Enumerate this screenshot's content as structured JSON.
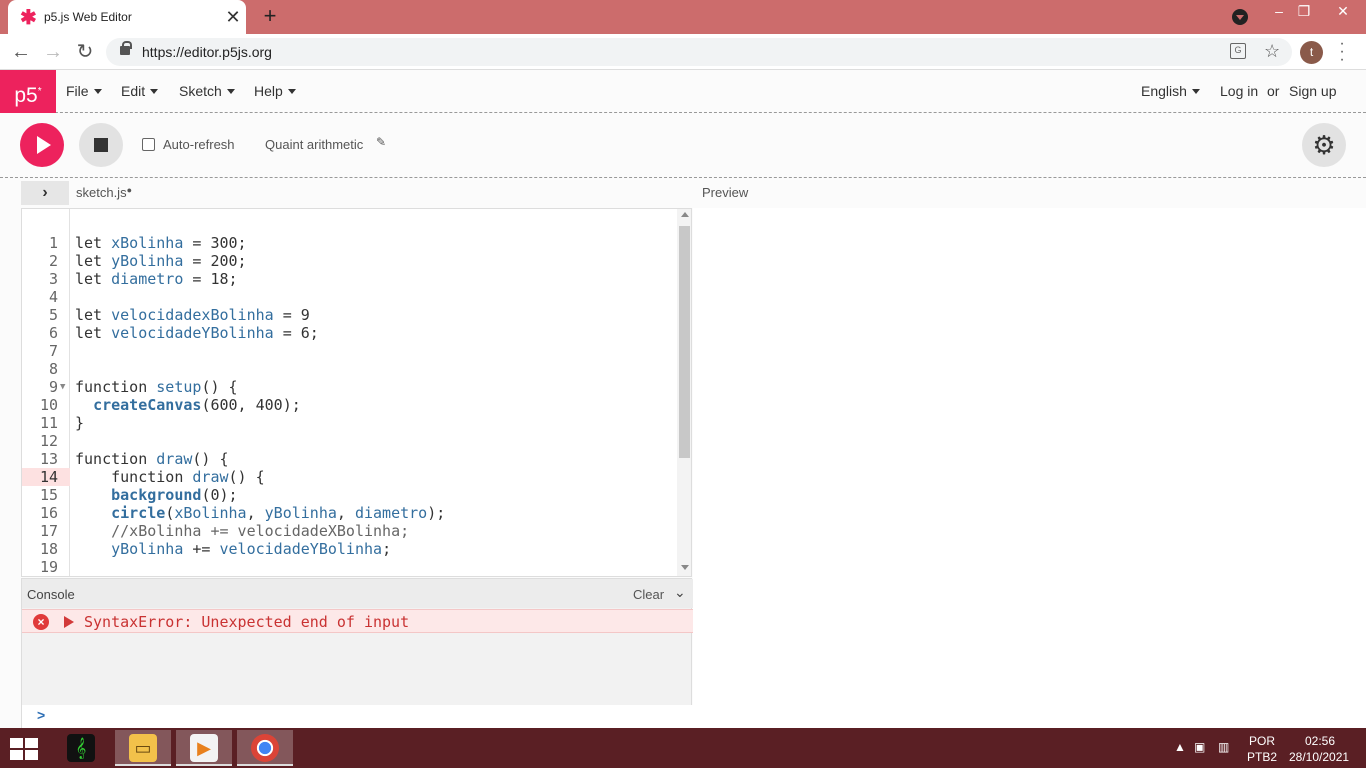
{
  "browser": {
    "tab_title": "p5.js Web Editor",
    "tab_close": "✕",
    "new_tab": "+",
    "url": "https://editor.p5js.org",
    "avatar_letter": "t",
    "window": {
      "minimize": "–",
      "restore": "❐",
      "close": "✕"
    }
  },
  "p5nav": {
    "logo": "p5",
    "logo_sup": "*",
    "menus": [
      "File",
      "Edit",
      "Sketch",
      "Help"
    ],
    "language": "English",
    "login": "Log in",
    "or": "or",
    "signup": "Sign up"
  },
  "toolbar": {
    "auto_refresh": "Auto-refresh",
    "sketch_name": "Quaint arithmetic",
    "pencil": "✎"
  },
  "editor": {
    "file_tab": "sketch.js",
    "file_modified_dot": "●",
    "preview_label": "Preview",
    "lines": [
      {
        "n": "1"
      },
      {
        "n": "2"
      },
      {
        "n": "3"
      },
      {
        "n": "4"
      },
      {
        "n": "5"
      },
      {
        "n": "6"
      },
      {
        "n": "7"
      },
      {
        "n": "8"
      },
      {
        "n": "9"
      },
      {
        "n": "10"
      },
      {
        "n": "11"
      },
      {
        "n": "12"
      },
      {
        "n": "13"
      },
      {
        "n": "14"
      },
      {
        "n": "15"
      },
      {
        "n": "16"
      },
      {
        "n": "17"
      },
      {
        "n": "18"
      },
      {
        "n": "19"
      }
    ],
    "code_tokens": {
      "l1": [
        "let ",
        "xBolinha",
        " = 300;"
      ],
      "l2": [
        "let ",
        "yBolinha",
        " = 200;"
      ],
      "l3": [
        "let ",
        "diametro",
        " = 18;"
      ],
      "l5": [
        "let ",
        "velocidadexBolinha",
        " = 9"
      ],
      "l6": [
        "let ",
        "velocidadeYBolinha",
        " = 6;"
      ],
      "l9": [
        "function ",
        "setup",
        "() {"
      ],
      "l10": [
        "  ",
        "createCanvas",
        "(600, 400);"
      ],
      "l11": [
        "}"
      ],
      "l13": [
        "function ",
        "draw",
        "() {"
      ],
      "l14": [
        "    function ",
        "draw",
        "() {"
      ],
      "l15": [
        "    ",
        "background",
        "(0);"
      ],
      "l16": [
        "    ",
        "circle",
        "(",
        "xBolinha",
        ", ",
        "yBolinha",
        ", ",
        "diametro",
        ");"
      ],
      "l17": [
        "    //xBolinha += velocidadeXBolinha;"
      ],
      "l18": [
        "    ",
        "yBolinha",
        " += ",
        "velocidadeYBolinha",
        ";"
      ]
    }
  },
  "console": {
    "title": "Console",
    "clear": "Clear",
    "error_message": "SyntaxError: Unexpected end of input",
    "prompt": ">"
  },
  "taskbar": {
    "lang_top": "POR",
    "lang_bottom": "PTB2",
    "time": "02:56",
    "date": "28/10/2021"
  },
  "colors": {
    "p5_pink": "#ed225d",
    "tab_bar": "#cc6c6c",
    "taskbar": "#5a1f24",
    "error_red": "#c93232"
  }
}
